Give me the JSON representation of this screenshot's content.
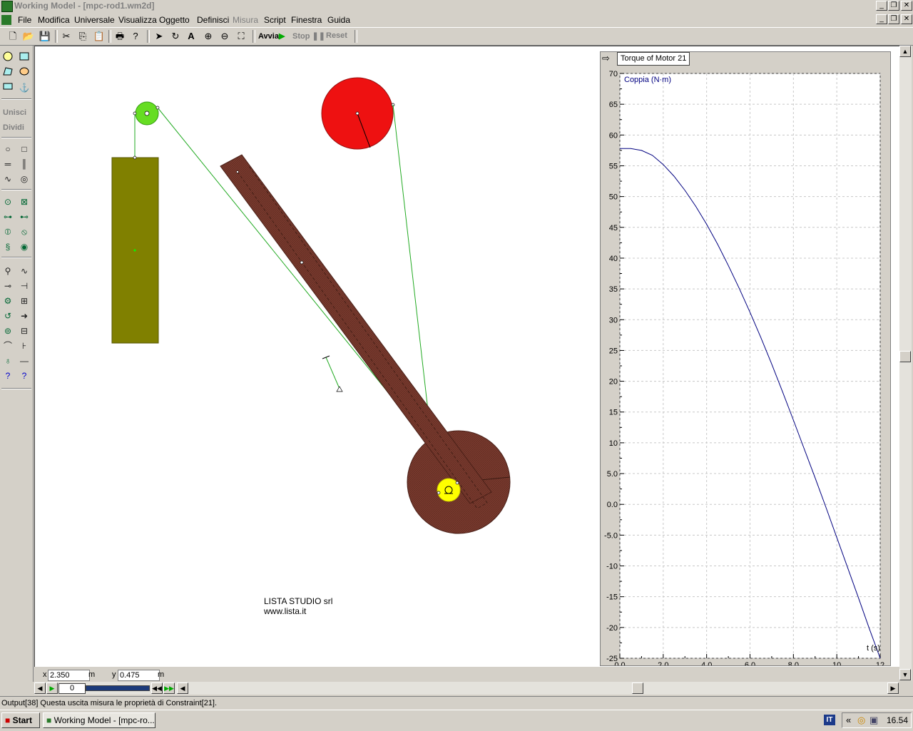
{
  "window": {
    "title": "Working Model - [mpc-rod1.wm2d]"
  },
  "menu": [
    {
      "label": "File",
      "disabled": false
    },
    {
      "label": "Modifica",
      "disabled": false
    },
    {
      "label": "Universale",
      "disabled": false
    },
    {
      "label": "Visualizza",
      "disabled": false
    },
    {
      "label": "Oggetto",
      "disabled": false
    },
    {
      "label": "Definisci",
      "disabled": false
    },
    {
      "label": "Misura",
      "disabled": true
    },
    {
      "label": "Script",
      "disabled": false
    },
    {
      "label": "Finestra",
      "disabled": false
    },
    {
      "label": "Guida",
      "disabled": false
    }
  ],
  "toolbar": {
    "run_label": "Avvia",
    "stop_label": "Stop",
    "reset_label": "Reset"
  },
  "palette": {
    "join_label": "Unisci",
    "split_label": "Dividi"
  },
  "workspace": {
    "credit_line1": "LISTA STUDIO srl",
    "credit_line2": "www.lista.it",
    "colors": {
      "block": "#808000",
      "pulley_small": "#66dd22",
      "pulley_large": "#ee1111",
      "rod": "#7a3a2e",
      "motor_disc": "#7a3a2e",
      "motor_hub": "#ffff00",
      "rope": "#22aa22"
    }
  },
  "graph": {
    "header": "Torque of Motor 21"
  },
  "chart_data": {
    "type": "line",
    "title": "Torque of Motor 21",
    "series_label": "Coppia (N·m)",
    "xlabel": "t (s)",
    "ylabel": "",
    "xlim": [
      0,
      12
    ],
    "ylim": [
      -25,
      70
    ],
    "x_ticks": [
      "0.0",
      "2.0",
      "4.0",
      "6.0",
      "8.0",
      "10",
      "12"
    ],
    "y_ticks": [
      "70",
      "65",
      "60",
      "55",
      "50",
      "45",
      "40",
      "35",
      "30",
      "25",
      "20",
      "15",
      "10",
      "5.0",
      "0.0",
      "-5.0",
      "-10",
      "-15",
      "-20",
      "-25"
    ],
    "grid": true,
    "series": [
      {
        "name": "Coppia (N·m)",
        "color": "#000080",
        "x": [
          0,
          0.5,
          1,
          1.5,
          2,
          2.5,
          3,
          3.5,
          4,
          4.5,
          5,
          5.5,
          6,
          6.5,
          7,
          7.5,
          8,
          8.5,
          9,
          9.5,
          10,
          10.5,
          11,
          11.5,
          12
        ],
        "y": [
          57.8,
          57.8,
          57.5,
          56.7,
          55.2,
          53.3,
          51.0,
          48.4,
          45.5,
          42.3,
          38.8,
          35.1,
          31.2,
          27.1,
          22.8,
          18.3,
          13.7,
          9.0,
          4.3,
          -0.5,
          -5.4,
          -10.3,
          -15.2,
          -20.2,
          -25.0
        ]
      }
    ]
  },
  "coords": {
    "x_label": "x",
    "x_value": "2.350",
    "x_unit": "m",
    "y_label": "y",
    "y_value": "0.475",
    "y_unit": "m"
  },
  "playback": {
    "frame": "0"
  },
  "status": {
    "text": "Output[38]   Questa uscita misura le proprietà di Constraint[21]."
  },
  "taskbar": {
    "start_label": "Start",
    "task_label": "Working Model - [mpc-ro...",
    "lang": "IT",
    "clock": "16.54"
  }
}
